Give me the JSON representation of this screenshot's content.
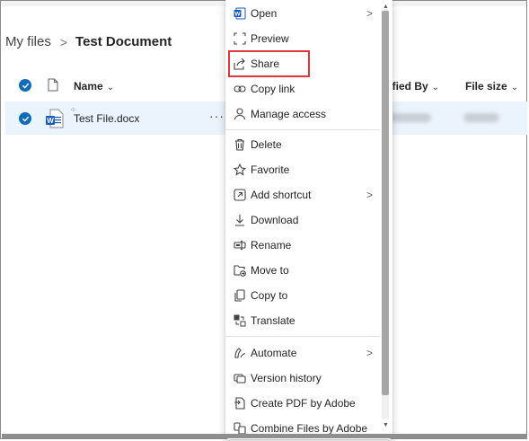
{
  "breadcrumb": {
    "root": "My files",
    "separator": ">",
    "current": "Test Document"
  },
  "columns": {
    "name": "Name",
    "modified_by": "dified By",
    "file_size": "File size"
  },
  "file_row": {
    "name": "Test File.docx",
    "more": "···"
  },
  "menu": {
    "items": [
      {
        "label": "Open",
        "icon": "word-icon",
        "submenu": true
      },
      {
        "label": "Preview",
        "icon": "preview-icon",
        "submenu": false
      },
      {
        "label": "Share",
        "icon": "share-icon",
        "submenu": false
      },
      {
        "label": "Copy link",
        "icon": "link-icon",
        "submenu": false
      },
      {
        "label": "Manage access",
        "icon": "person-icon",
        "submenu": false
      },
      {
        "label": "Delete",
        "icon": "trash-icon",
        "submenu": false
      },
      {
        "label": "Favorite",
        "icon": "star-icon",
        "submenu": false
      },
      {
        "label": "Add shortcut",
        "icon": "shortcut-icon",
        "submenu": true
      },
      {
        "label": "Download",
        "icon": "download-icon",
        "submenu": false
      },
      {
        "label": "Rename",
        "icon": "rename-icon",
        "submenu": false
      },
      {
        "label": "Move to",
        "icon": "move-icon",
        "submenu": false
      },
      {
        "label": "Copy to",
        "icon": "copy-icon",
        "submenu": false
      },
      {
        "label": "Translate",
        "icon": "translate-icon",
        "submenu": false
      },
      {
        "label": "Automate",
        "icon": "automate-icon",
        "submenu": true
      },
      {
        "label": "Version history",
        "icon": "history-icon",
        "submenu": false
      },
      {
        "label": "Create PDF by Adobe",
        "icon": "pdf-icon",
        "submenu": false
      },
      {
        "label": "Combine Files by Adobe",
        "icon": "combine-icon",
        "submenu": false
      }
    ],
    "submenu_glyph": ">"
  },
  "colors": {
    "accent": "#0f6cbd",
    "selected_row": "#ebf3fc",
    "highlight_box": "#e0353d"
  }
}
